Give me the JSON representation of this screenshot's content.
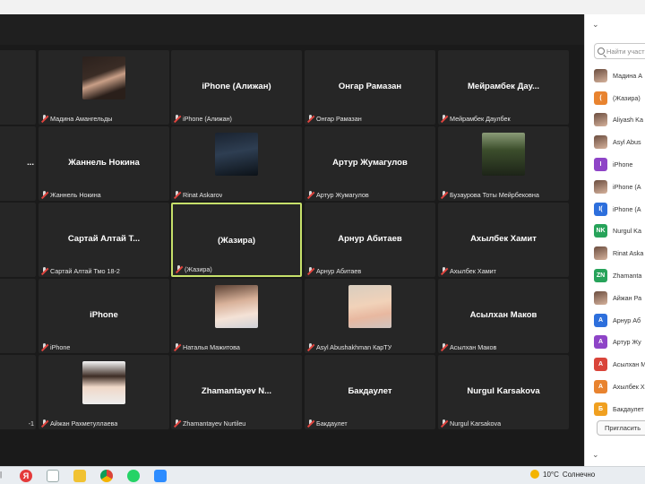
{
  "grid": {
    "tiles": [
      {
        "big": "",
        "footer": ""
      },
      {
        "big": "",
        "footer": "Мадина Амангельды",
        "photo": "madina"
      },
      {
        "big": "iPhone (Алижан)",
        "footer": "iPhone (Алижан)"
      },
      {
        "big": "Онгар Рамазан",
        "footer": "Онгар Рамазан"
      },
      {
        "big": "Мейрамбек  Дау...",
        "footer": "Мейрамбек Даулбек"
      },
      {
        "big": "...",
        "footer": ""
      },
      {
        "big": "Жаннель Нокина",
        "footer": "Жаннель Нокина"
      },
      {
        "big": "",
        "footer": "Rinat Askarov",
        "photo": "rinat"
      },
      {
        "big": "Артур Жумагулов",
        "footer": "Артур Жумагулов"
      },
      {
        "big": "",
        "footer": "Бузаурова Тоты Мейрбековна",
        "photo": "buz"
      },
      {
        "big": "",
        "footer": ""
      },
      {
        "big": "Сартай Алтай Т...",
        "footer": "Сартай Алтай Тмо 18-2"
      },
      {
        "big": "(Жазира)",
        "footer": "(Жазира)",
        "active": true
      },
      {
        "big": "Арнур Абитаев",
        "footer": "Арнур Абитаев"
      },
      {
        "big": "Ахылбек Хамит",
        "footer": "Ахылбек Хамит"
      },
      {
        "big": "",
        "footer": ""
      },
      {
        "big": "iPhone",
        "footer": "iPhone"
      },
      {
        "big": "",
        "footer": "Наталья Мажитова",
        "photo": "nat"
      },
      {
        "big": "",
        "footer": "Asyl Abushakhman КарТУ",
        "photo": "asyl"
      },
      {
        "big": "Асылхан Маков",
        "footer": "Асылхан Маков"
      },
      {
        "big": "",
        "footer": "-1"
      },
      {
        "big": "",
        "footer": "Айжан Рахметуллаева",
        "photo": "aij"
      },
      {
        "big": "Zhamantayev  N...",
        "footer": "Zhamantayev Nurtileu"
      },
      {
        "big": "Бакдаулет",
        "footer": "Бакдаулет"
      },
      {
        "big": "Nurgul Karsakova",
        "footer": "Nurgul Karsakova"
      }
    ]
  },
  "sidebar": {
    "search_placeholder": "Найти участ",
    "participants": [
      {
        "avatar": "",
        "avatar_type": "img",
        "name": "Мадина А"
      },
      {
        "avatar": "(",
        "color": "#e8832f",
        "name": "(Жазира)"
      },
      {
        "avatar": "",
        "avatar_type": "img",
        "name": "Aliyash Ka"
      },
      {
        "avatar": "",
        "avatar_type": "img",
        "name": "Asyl Abus"
      },
      {
        "avatar": "I",
        "color": "#8e44c7",
        "name": "iPhone"
      },
      {
        "avatar": "",
        "avatar_type": "img",
        "name": "iPhone (А"
      },
      {
        "avatar": "I(",
        "color": "#2d6fdc",
        "name": "iPhone (А"
      },
      {
        "avatar": "NK",
        "color": "#27a35a",
        "name": "Nurgul Ka"
      },
      {
        "avatar": "",
        "avatar_type": "img",
        "name": "Rinat Aska"
      },
      {
        "avatar": "ZN",
        "color": "#27a35a",
        "name": "Zhamanta"
      },
      {
        "avatar": "",
        "avatar_type": "img",
        "name": "Айжан Ра"
      },
      {
        "avatar": "А",
        "color": "#2d6fdc",
        "name": "Арнур Аб"
      },
      {
        "avatar": "А",
        "color": "#8e44c7",
        "name": "Артур Жу"
      },
      {
        "avatar": "А",
        "color": "#d9443a",
        "name": "Асылхан М"
      },
      {
        "avatar": "А",
        "color": "#e8832f",
        "name": "Ахылбек Х"
      },
      {
        "avatar": "Б",
        "color": "#f0a020",
        "name": "Бакдаулет"
      }
    ],
    "invite_label": "Пригласить"
  },
  "taskbar": {
    "temperature": "10°C",
    "weather": "Солнечно"
  }
}
